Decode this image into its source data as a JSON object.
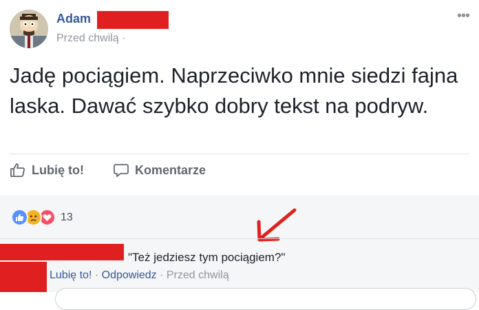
{
  "post": {
    "author_name": "Adam",
    "timestamp": "Przed chwilą ·",
    "more_icon": "ellipsis-icon",
    "text": "Jadę pociągiem. Naprzeciwko mnie siedzi fajna laska. Dawać szybko dobry tekst na podryw."
  },
  "actions": {
    "like_label": "Lubię to!",
    "comment_label": "Komentarze"
  },
  "reactions": {
    "icons": [
      "like-reaction-icon",
      "sad-reaction-icon",
      "love-reaction-icon"
    ],
    "count": "13",
    "colors": {
      "like": "#5890ff",
      "sad": "#f7b125",
      "love": "#f25268"
    }
  },
  "comment": {
    "text": "\"Też jedziesz tym pociągiem?\"",
    "like_label": "Lubię to!",
    "separator": "·",
    "reply_label": "Odpowiedz",
    "timestamp": "Przed chwilą"
  },
  "annotation": {
    "arrow_color": "#e02020"
  },
  "colors": {
    "link": "#365899",
    "meta": "#90949c",
    "redaction": "#e02020",
    "text": "#1d2129"
  }
}
